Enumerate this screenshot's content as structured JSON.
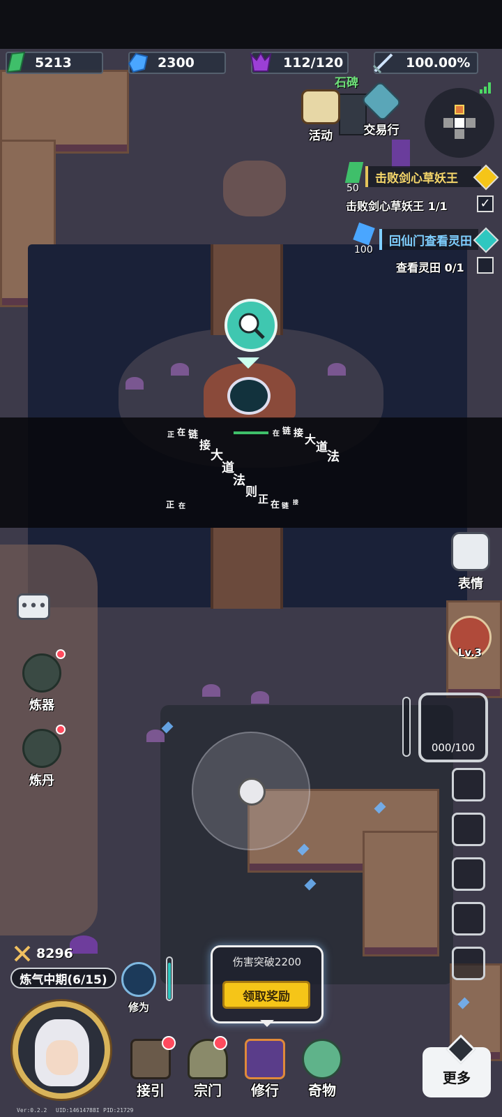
{
  "resources": {
    "jade": "5213",
    "crystal": "2300",
    "stamina": "112/120",
    "rate": "100.00%"
  },
  "map_labels": {
    "stele": "石碑"
  },
  "top_buttons": {
    "activity": "活动",
    "trade": "交易行"
  },
  "quests": [
    {
      "reward": "50",
      "title": "击败剑心草妖王",
      "progress": "击败剑心草妖王 1/1"
    },
    {
      "reward": "100",
      "title": "回仙门查看灵田",
      "progress": "查看灵田 0/1"
    }
  ],
  "loading": {
    "chars": [
      "正",
      "在",
      "链",
      "接",
      "大",
      "道",
      "法",
      "在",
      "链",
      "接",
      "大",
      "道",
      "法",
      "则",
      "正",
      "在",
      "链",
      "接",
      "正",
      "在"
    ]
  },
  "right_buttons": {
    "emote": "表情",
    "gourd_level": "Lv.3",
    "capacity": "000/100"
  },
  "left_buttons": {
    "refine": "炼器",
    "alchemy": "炼丹"
  },
  "player": {
    "power": "8296",
    "realm": "炼气中期(6/15)",
    "cultivation_label": "修为"
  },
  "reward_panel": {
    "text": "伤害突破2200",
    "button": "领取奖励"
  },
  "bottom_nav": [
    {
      "label": "接引"
    },
    {
      "label": "宗门"
    },
    {
      "label": "修行"
    },
    {
      "label": "奇物"
    },
    {
      "label": "更多"
    }
  ],
  "footer": {
    "version": "Ver:0.2.2",
    "uid": "UID:14614788I",
    "pid": "PID:21729"
  },
  "colors": {
    "accent": "#f5c518",
    "quest_gold": "#e6c45a",
    "quest_blue": "#7fd0ff",
    "alert_red": "#ff4b5e"
  }
}
